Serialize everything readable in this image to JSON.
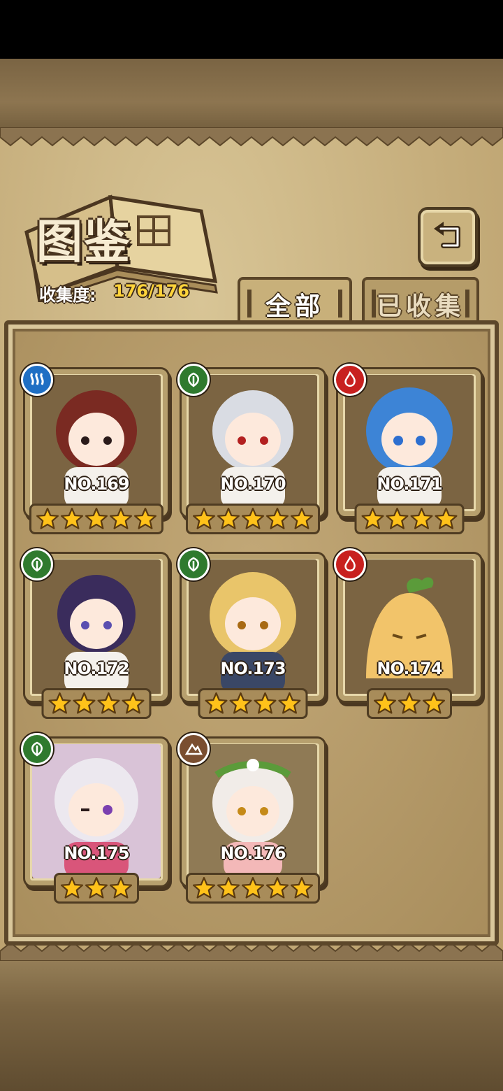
{
  "header": {
    "title": "图鉴",
    "collection_label": "收集度:",
    "collection_value": "176/176"
  },
  "tabs": [
    {
      "label": "全部",
      "active": true
    },
    {
      "label": "已收集",
      "active": false
    }
  ],
  "colors": {
    "element_water": "#1f6fc4",
    "element_grass": "#2f7a2e",
    "element_fire": "#c8201f",
    "element_earth": "#7a4e30",
    "star": "#ffc21a",
    "number_text": "#ffffff"
  },
  "icons": {
    "back": "return-arrow-icon",
    "star": "star-icon"
  },
  "cards": [
    {
      "number": "NO.169",
      "stars": 5,
      "element": "water",
      "element_icon": "water-element-icon",
      "hair": "#7a2a22"
    },
    {
      "number": "NO.170",
      "stars": 5,
      "element": "grass",
      "element_icon": "grass-element-icon",
      "hair": "#d9dce3"
    },
    {
      "number": "NO.171",
      "stars": 4,
      "element": "fire",
      "element_icon": "fire-element-icon",
      "hair": "#3d84d6"
    },
    {
      "number": "NO.172",
      "stars": 4,
      "element": "grass",
      "element_icon": "grass-element-icon",
      "hair": "#3a2c5c"
    },
    {
      "number": "NO.173",
      "stars": 4,
      "element": "grass",
      "element_icon": "grass-element-icon",
      "hair": "#e9c56a"
    },
    {
      "number": "NO.174",
      "stars": 3,
      "element": "fire",
      "element_icon": "fire-element-icon",
      "hair": "#f2c46a"
    },
    {
      "number": "NO.175",
      "stars": 3,
      "element": "grass",
      "element_icon": "grass-element-icon",
      "hair": "#ece8ef"
    },
    {
      "number": "NO.176",
      "stars": 5,
      "element": "earth",
      "element_icon": "earth-element-icon",
      "hair": "#f1ece8"
    }
  ]
}
